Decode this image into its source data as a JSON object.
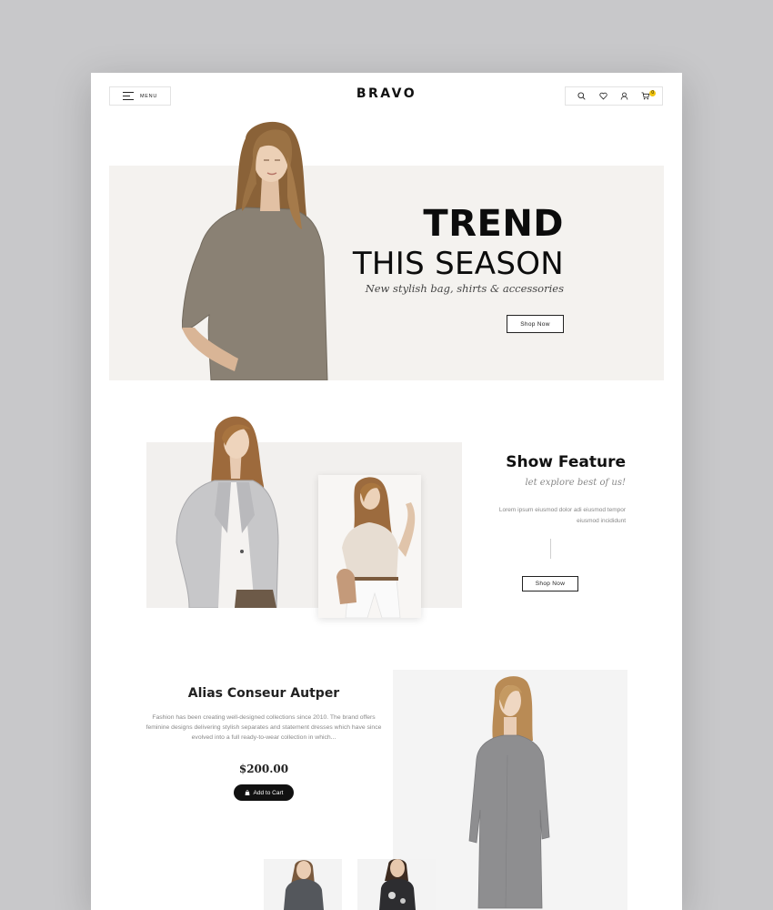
{
  "header": {
    "menu_label": "MENU",
    "logo": "BRAVO",
    "cart_count": "0",
    "icons": [
      "search-icon",
      "heart-icon",
      "user-icon",
      "cart-icon"
    ]
  },
  "hero": {
    "title_line1": "TREND",
    "title_line2": "THIS SEASON",
    "subtitle": "New stylish bag, shirts & accessories",
    "button_label": "Shop Now"
  },
  "feature": {
    "title": "Show Feature",
    "subtitle": "let explore best of us!",
    "description_line1": "Lorem ipsum eiusmod dolor adi eiusmod tempor",
    "description_line2": "eiusmod incididunt",
    "button_label": "Shop Now"
  },
  "product": {
    "title": "Alias Conseur Autper",
    "description": "Fashion has been creating well-designed collections since 2010. The brand offers feminine designs delivering stylish separates and statement dresses which have since evolved into a full ready-to-wear collection in which...",
    "price": "$200.00",
    "button_label": "Add to Cart"
  },
  "colors": {
    "hero_bg": "#f4f2ef",
    "accent_badge": "#f1c40f",
    "dark": "#111111"
  }
}
